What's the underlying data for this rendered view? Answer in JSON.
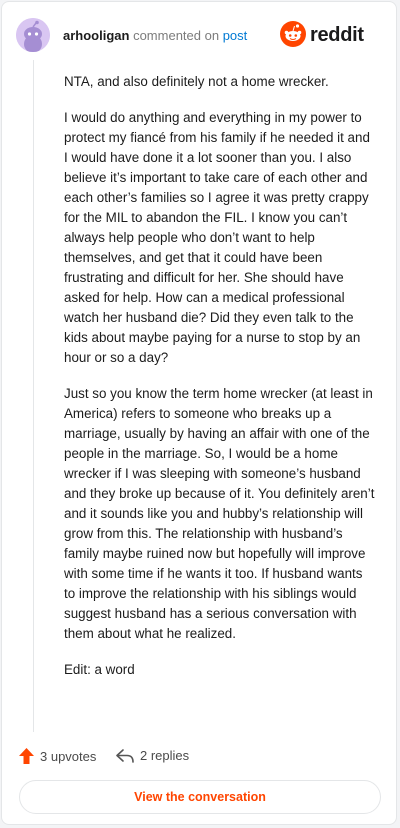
{
  "header": {
    "username": "arhooligan",
    "action_text": "commented on",
    "post_link": "post",
    "logo_word": "reddit"
  },
  "comment": {
    "paragraphs": [
      "NTA, and also definitely not a home wrecker.",
      "I would do anything and everything in my power to protect my fiancé from his family if he needed it and I would have done it a lot sooner than you. I also believe it’s important to take care of each other and each other’s families so I agree it was pretty crappy for the MIL to abandon the FIL. I know you can’t always help people who don’t want to help themselves, and get that it could have been frustrating and difficult for her. She should have asked for help. How can a medical professional watch her husband die? Did they even talk to the kids about maybe paying for a nurse to stop by an hour or so a day?",
      "Just so you know the term home wrecker (at least in America) refers to someone who breaks up a marriage, usually by having an affair with one of the people in the marriage. So, I would be a home wrecker if I was sleeping with someone’s husband and they broke up because of it. You definitely aren’t and it sounds like you and hubby’s relationship will grow from this. The relationship with husband’s family maybe ruined now but hopefully will improve with some time if he wants it too. If husband wants to improve the relationship with his siblings would suggest husband has a serious conversation with them about what he realized.",
      "Edit: a word"
    ]
  },
  "footer": {
    "upvotes_label": "3 upvotes",
    "replies_label": "2 replies",
    "view_button_label": "View the conversation"
  },
  "colors": {
    "accent": "#ff4500",
    "link": "#0079d3",
    "avatar_bg": "#d9c6f2"
  },
  "icons": {
    "avatar": "snoo-avatar-icon",
    "logo": "reddit-snoo-logo-icon",
    "upvote": "upvote-arrow-icon",
    "reply": "reply-arrow-icon"
  }
}
